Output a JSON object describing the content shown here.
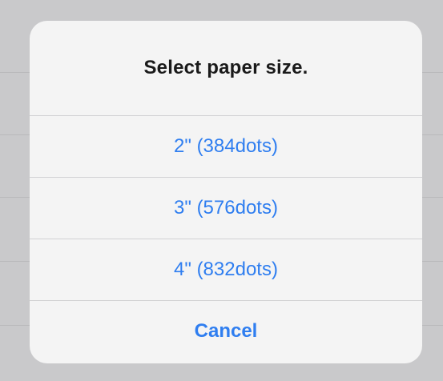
{
  "alert": {
    "title": "Select paper size.",
    "options": [
      {
        "label": "2\" (384dots)"
      },
      {
        "label": "3\" (576dots)"
      },
      {
        "label": "4\" (832dots)"
      }
    ],
    "cancel_label": "Cancel"
  },
  "colors": {
    "accent": "#2f7ef0",
    "backdrop": "#c9c9cb",
    "sheet": "#f4f4f4",
    "title_text": "#1a1a1a"
  }
}
